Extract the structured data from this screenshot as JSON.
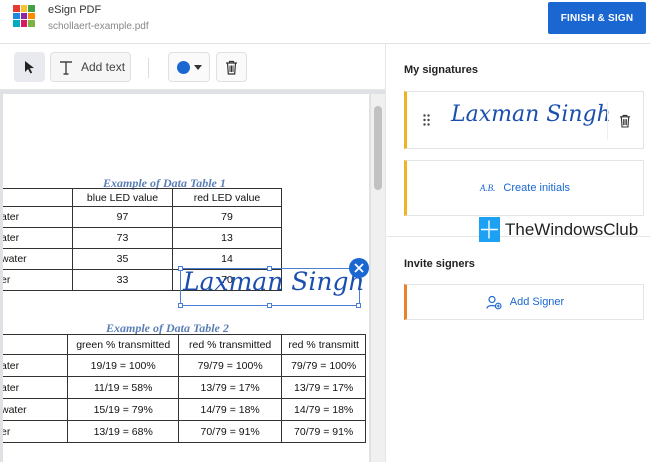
{
  "header": {
    "app_title": "eSign PDF",
    "file_name": "schollaert-example.pdf",
    "finish_button": "FINISH & SIGN",
    "logo_colors": [
      "#e53935",
      "#fbc02d",
      "#43a047",
      "#1e88e5",
      "#8e24aa",
      "#fb8c00",
      "#00acc1",
      "#d81b60",
      "#7cb342"
    ]
  },
  "toolbar": {
    "select_icon": "cursor-arrow-icon",
    "text_icon": "text-t-icon",
    "add_text_label": "Add text",
    "color": "#1a67d2",
    "delete_icon": "trash-icon"
  },
  "document": {
    "table1": {
      "title": "Example of Data Table 1",
      "headers": [
        "",
        "blue LED value",
        "red LED value"
      ],
      "rows": [
        {
          "label": "ater",
          "blue": "97",
          "red": "79"
        },
        {
          "label": "ater",
          "blue": "73",
          "red": "13"
        },
        {
          "label": "water",
          "blue": "35",
          "red": "14"
        },
        {
          "label": "er",
          "blue": "33",
          "red": "70"
        }
      ]
    },
    "table2": {
      "title": "Example of Data Table 2",
      "headers": [
        "",
        "green % transmitted",
        "red % transmitted",
        "red % transmitt"
      ],
      "rows": [
        {
          "label": "ater",
          "c1": "19/19 = 100%",
          "c2": "79/79 = 100%",
          "c3": "79/79 = 100%"
        },
        {
          "label": "ater",
          "c1": "11/19 = 58%",
          "c2": "13/79 = 17%",
          "c3": "13/79 = 17%"
        },
        {
          "label": "water",
          "c1": "15/19 = 79%",
          "c2": "14/79 = 18%",
          "c3": "14/79 = 18%"
        },
        {
          "label": "er",
          "c1": "13/19 = 68%",
          "c2": "70/79 = 91%",
          "c3": "70/79 = 91%"
        }
      ]
    },
    "placed_signature": "Laxman Singh"
  },
  "panel": {
    "my_signatures_title": "My signatures",
    "signature_text": "Laxman Singh",
    "initials_abbr": "A.B.",
    "create_initials": "Create initials",
    "invite_signers_title": "Invite signers",
    "add_signer": "Add Signer",
    "accent_color": "#f0b429",
    "signer_accent_color": "#e8822c"
  },
  "watermark": {
    "text": "TheWindowsClub"
  }
}
